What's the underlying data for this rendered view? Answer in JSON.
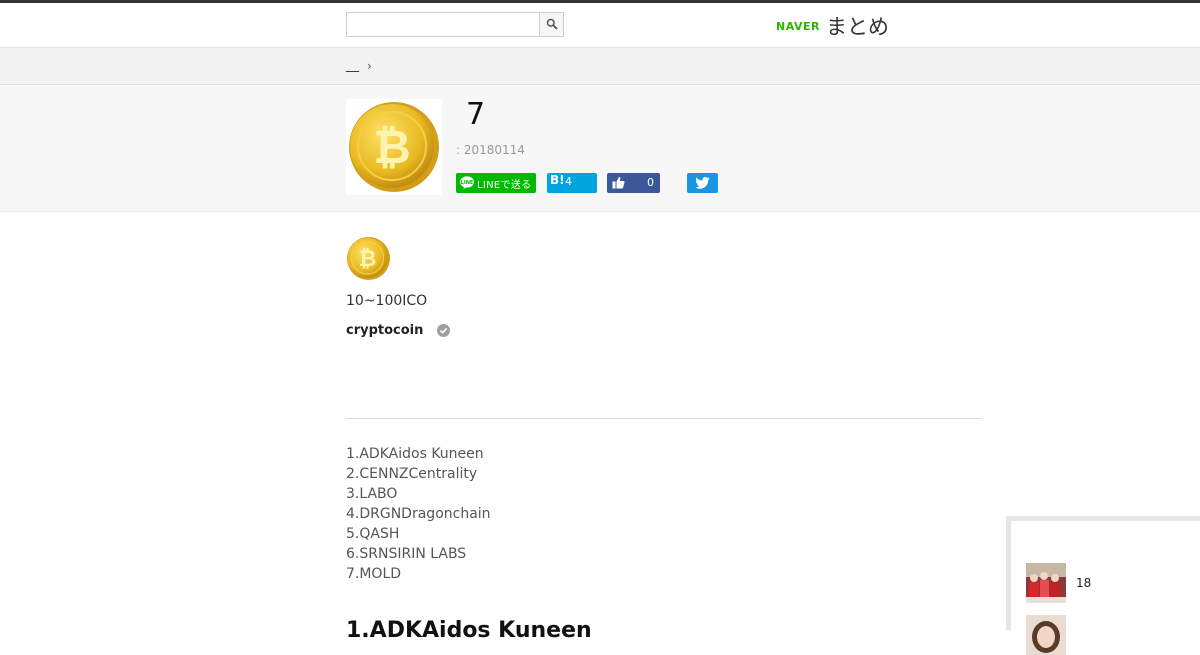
{
  "header": {
    "search": {
      "placeholder": "",
      "value": ""
    },
    "logo": {
      "brand": "NAVER",
      "product": "まとめ"
    }
  },
  "breadcrumb": {
    "items": [
      "__"
    ],
    "separator": "›"
  },
  "hero": {
    "title": "7",
    "date": ": 20180114",
    "share": {
      "line_label": "LINEで送る",
      "hatena_logo": "B!",
      "hatena_count": "4",
      "facebook_count": "0"
    }
  },
  "summary": {
    "description": "10~100ICO",
    "author": "cryptocoin"
  },
  "toc": {
    "items": [
      "1.ADKAidos Kuneen",
      "2.CENNZCentrality",
      "3.LABO",
      "4.DRGNDragonchain",
      "5.QASH",
      "6.SRNSIRIN LABS",
      "7.MOLD"
    ]
  },
  "section": {
    "heading": "1.ADKAidos Kuneen"
  },
  "side_panel": {
    "items": [
      {
        "count": "18"
      },
      {
        "count": ""
      }
    ]
  },
  "colors": {
    "line": "#00b900",
    "hatena": "#00a4de",
    "facebook": "#3b5998",
    "twitter": "#1b95e0",
    "naver_green": "#2db400",
    "coin_gold": "#e8b923"
  },
  "icons": {
    "search": "magnifier-icon",
    "line": "line-icon",
    "facebook": "thumbs-up-icon",
    "twitter": "twitter-bird-icon",
    "verified": "check-circle-icon"
  }
}
